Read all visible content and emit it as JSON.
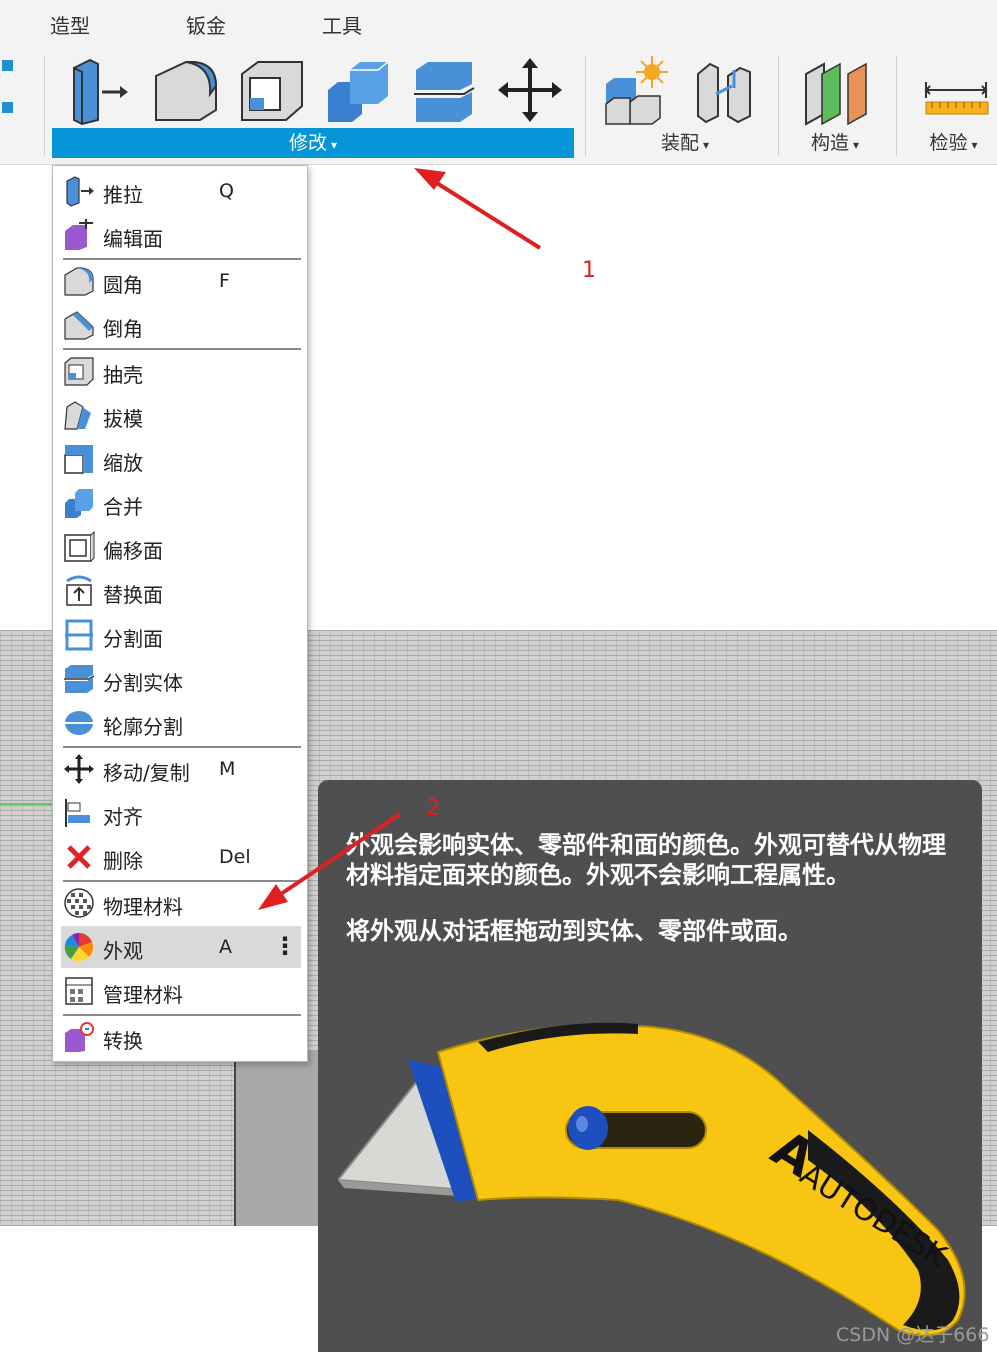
{
  "tabs": [
    "造型",
    "钣金",
    "工具"
  ],
  "ribbon": {
    "groups": {
      "modify": "修改",
      "assemble": "装配",
      "construct": "构造",
      "inspect": "检验"
    },
    "caret": "▾"
  },
  "menu": {
    "items": [
      {
        "label": "推拉",
        "key": "Q",
        "icon": "press-pull-icon"
      },
      {
        "label": "编辑面",
        "key": "",
        "icon": "edit-face-icon"
      },
      {
        "label": "圆角",
        "key": "F",
        "icon": "fillet-icon"
      },
      {
        "label": "倒角",
        "key": "",
        "icon": "chamfer-icon"
      },
      {
        "label": "抽壳",
        "key": "",
        "icon": "shell-icon"
      },
      {
        "label": "拔模",
        "key": "",
        "icon": "draft-icon"
      },
      {
        "label": "缩放",
        "key": "",
        "icon": "scale-icon"
      },
      {
        "label": "合并",
        "key": "",
        "icon": "combine-icon"
      },
      {
        "label": "偏移面",
        "key": "",
        "icon": "offset-face-icon"
      },
      {
        "label": "替换面",
        "key": "",
        "icon": "replace-face-icon"
      },
      {
        "label": "分割面",
        "key": "",
        "icon": "split-face-icon"
      },
      {
        "label": "分割实体",
        "key": "",
        "icon": "split-body-icon"
      },
      {
        "label": "轮廓分割",
        "key": "",
        "icon": "silhouette-split-icon"
      },
      {
        "label": "移动/复制",
        "key": "M",
        "icon": "move-copy-icon"
      },
      {
        "label": "对齐",
        "key": "",
        "icon": "align-icon"
      },
      {
        "label": "删除",
        "key": "Del",
        "icon": "delete-icon"
      },
      {
        "label": "物理材料",
        "key": "",
        "icon": "physical-material-icon"
      },
      {
        "label": "外观",
        "key": "A",
        "icon": "appearance-icon",
        "selected": true,
        "more": "⋮"
      },
      {
        "label": "管理材料",
        "key": "",
        "icon": "manage-materials-icon"
      },
      {
        "label": "转换",
        "key": "",
        "icon": "convert-icon"
      }
    ]
  },
  "tooltip": {
    "line1": "外观会影响实体、零部件和面的颜色。外观可替代从物理材料指定面来的颜色。外观不会影响工程属性。",
    "line2": "将外观从对话框拖动到实体、零部件或面。",
    "image_brand": "AUTODESK"
  },
  "annotations": {
    "one": "1",
    "two": "2"
  },
  "watermark": "CSDN @达子666",
  "colors": {
    "accent_blue": "#0696d7",
    "tooltip_bg": "#4f4f4f",
    "annotation_red": "#e02020",
    "knife_yellow": "#f7c512"
  }
}
